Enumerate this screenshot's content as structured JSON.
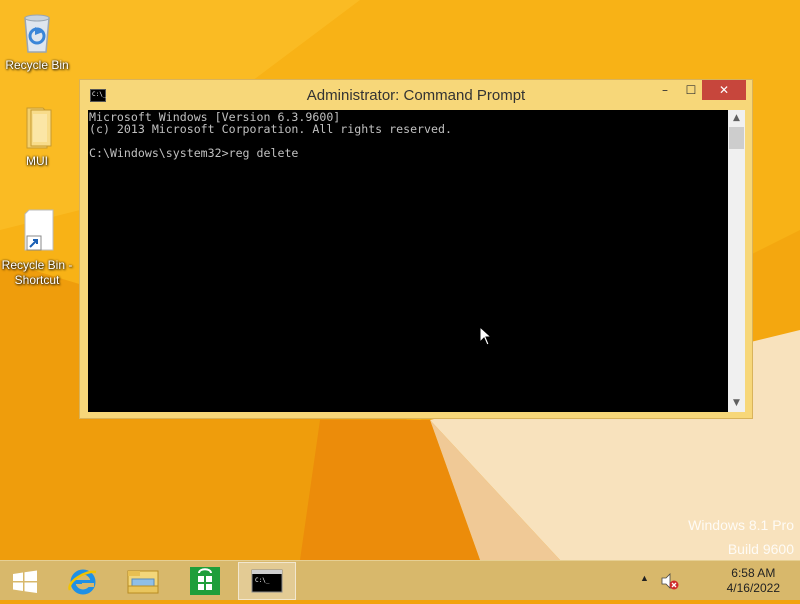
{
  "desktop": {
    "icons": [
      {
        "label": "Recycle Bin"
      },
      {
        "label": "MUI"
      },
      {
        "label": "Recycle Bin - Shortcut"
      }
    ],
    "watermark": {
      "line1": "Windows 8.1 Pro",
      "line2": "Build 9600"
    }
  },
  "window": {
    "title": "Administrator: Command Prompt",
    "icon_text": "C:\\_",
    "buttons": {
      "minimize": "–",
      "maximize": "☐",
      "close": "✕"
    },
    "console_lines": [
      "Microsoft Windows [Version 6.3.9600]",
      "(c) 2013 Microsoft Corporation. All rights reserved.",
      "",
      "C:\\Windows\\system32>reg delete"
    ]
  },
  "taskbar": {
    "items": [
      {
        "name": "start",
        "icon": "windows-logo-icon"
      },
      {
        "name": "internet-explorer",
        "icon": "internet-explorer-icon"
      },
      {
        "name": "file-explorer",
        "icon": "file-explorer-icon"
      },
      {
        "name": "store",
        "icon": "store-icon"
      },
      {
        "name": "command-prompt",
        "icon": "command-prompt-icon",
        "active": true
      }
    ],
    "tray": {
      "show_hidden": "▲",
      "volume_icon": "volume-muted-icon"
    },
    "clock": {
      "time": "6:58 AM",
      "date": "4/16/2022"
    }
  },
  "colors": {
    "accent": "#f2a20d",
    "window_frame": "#f7d779",
    "close": "#c7463c",
    "taskbar": "#d8b86b"
  }
}
